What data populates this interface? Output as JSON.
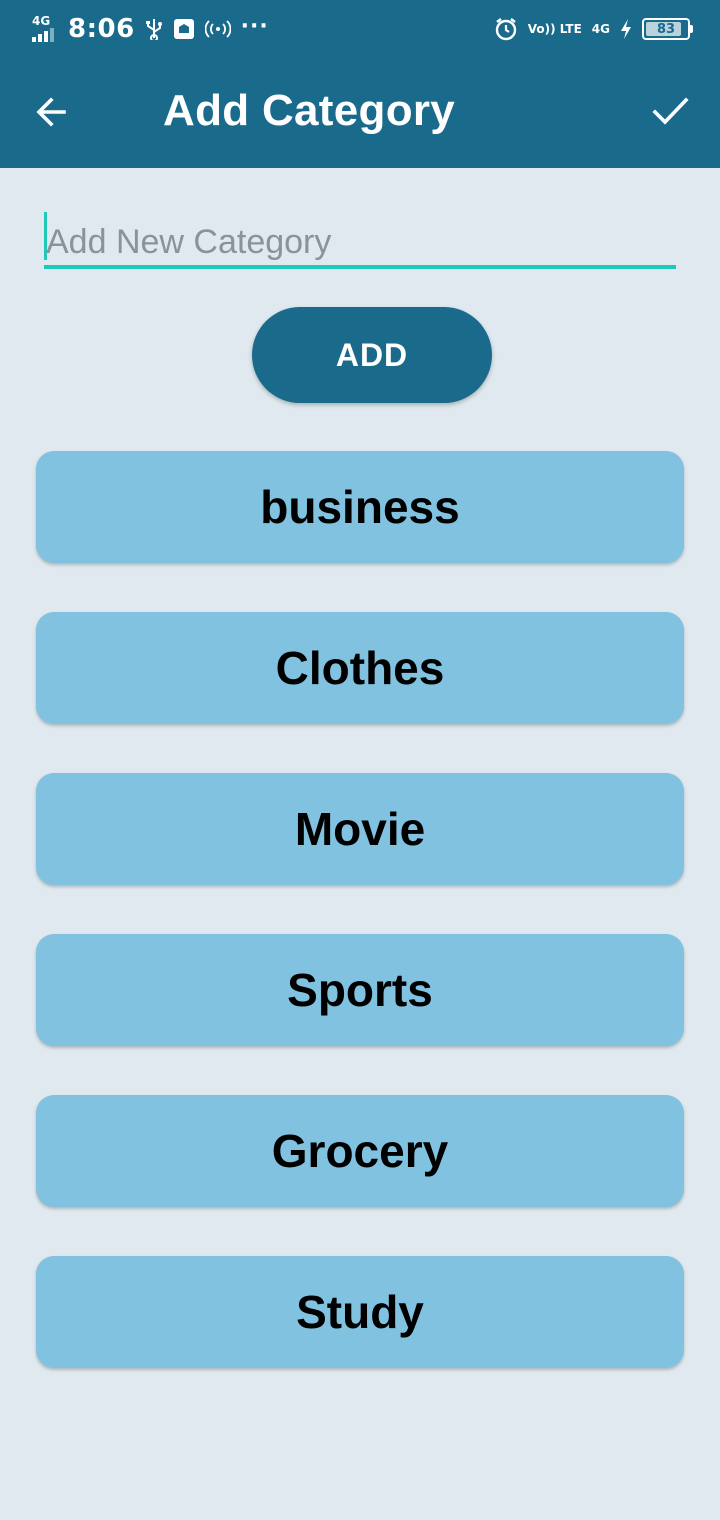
{
  "status_bar": {
    "network_left": "4G",
    "time": "8:06",
    "network_right": "4G",
    "volte": "Vo)) LTE",
    "battery": "83"
  },
  "header": {
    "title": "Add Category",
    "back_icon": "arrow-back-icon",
    "confirm_icon": "check-icon"
  },
  "form": {
    "input_value": "",
    "input_placeholder": "Add New Category",
    "add_label": "ADD"
  },
  "categories": [
    {
      "label": "business"
    },
    {
      "label": "Clothes"
    },
    {
      "label": "Movie"
    },
    {
      "label": "Sports"
    },
    {
      "label": "Grocery"
    },
    {
      "label": "Study"
    }
  ],
  "colors": {
    "header": "#1a6a8c",
    "background": "#dfe9ef",
    "item": "#80c2df",
    "accent": "#1fc9b8"
  }
}
